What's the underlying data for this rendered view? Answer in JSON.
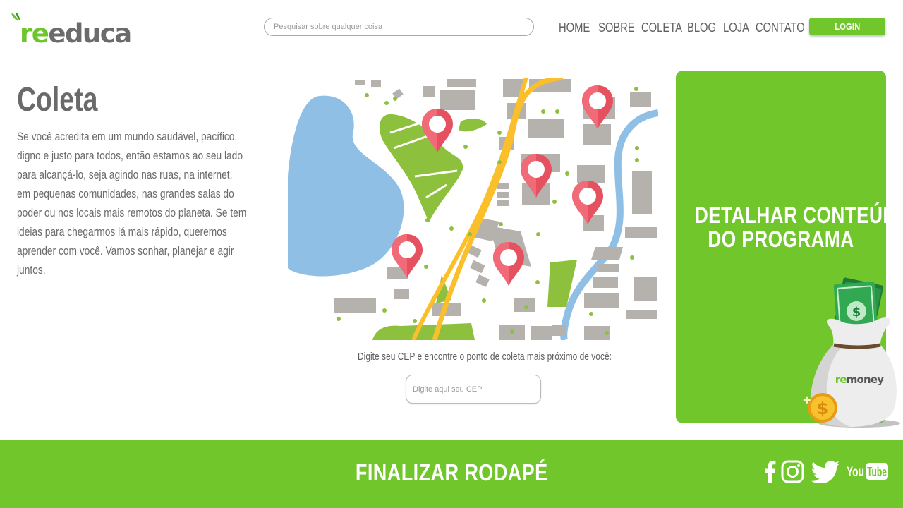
{
  "logo": {
    "prefix": "re",
    "suffix": "educa"
  },
  "search": {
    "placeholder": "Pesquisar sobre qualquer coisa"
  },
  "nav": {
    "items": [
      "HOME",
      "SOBRE",
      "COLETA",
      "BLOG",
      "LOJA",
      "CONTATO"
    ]
  },
  "login_label": "LOGIN",
  "main": {
    "title": "Coleta",
    "description": "Se você acredita em um mundo saudável, pacífico, digno e justo para todos, então estamos ao seu lado para alcançá-lo, seja agindo nas ruas, na internet, em pequenas comunidades, nas grandes salas do poder ou nos locais mais remotos do planeta. Se tem ideias para chegarmos lá mais rápido, queremos aprender com você. Vamos sonhar, planejar e agir juntos."
  },
  "cep": {
    "label": "Digite seu CEP e encontre o ponto de coleta mais próximo de você:",
    "placeholder": "Digite aqui seu CEP"
  },
  "card": {
    "line1": "DETALHAR CONTEÚDO",
    "line2": "DO PROGRAMA",
    "bag_label_re": "re",
    "bag_label_rest": "money"
  },
  "footer": {
    "title": "FINALIZAR RODAPÉ",
    "social": [
      "facebook-icon",
      "instagram-icon",
      "twitter-icon",
      "youtube-icon"
    ],
    "youtube_you": "You",
    "youtube_tube": "Tube"
  },
  "colors": {
    "brand_green": "#71c62b",
    "text_gray": "#6a6a6a",
    "map_water": "#90bfe6",
    "map_building": "#b5b2ad",
    "map_road": "#fbbf2c",
    "map_park": "#8dc03c",
    "map_pin": "#e6515f"
  }
}
